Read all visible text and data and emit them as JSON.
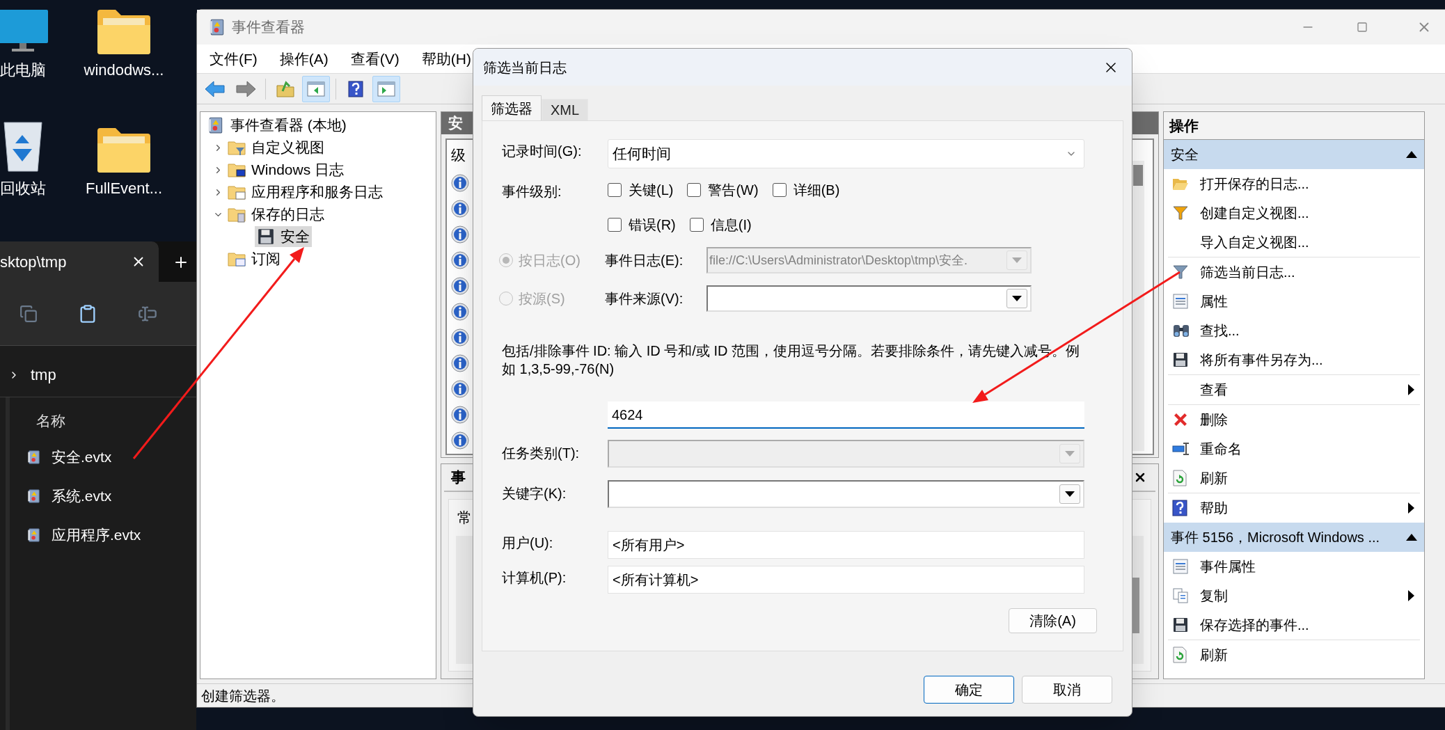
{
  "desktop": {
    "icons": [
      {
        "label": "此电脑",
        "kind": "pc"
      },
      {
        "label": "windodws...",
        "kind": "folder"
      },
      {
        "label": "回收站",
        "kind": "bin"
      },
      {
        "label": "FullEvent...",
        "kind": "folder"
      }
    ]
  },
  "explorer": {
    "tab": "sktop\\tmp",
    "breadcrumb": "tmp",
    "column": "名称",
    "files": [
      {
        "name": "安全.evtx"
      },
      {
        "name": "系统.evtx"
      },
      {
        "name": "应用程序.evtx"
      }
    ]
  },
  "event_viewer": {
    "title": "事件查看器",
    "menu": [
      "文件(F)",
      "操作(A)",
      "查看(V)",
      "帮助(H)"
    ],
    "toolbar": [
      {
        "kind": "back",
        "pressed": false
      },
      {
        "kind": "forward",
        "pressed": false
      },
      {
        "kind": "up",
        "pressed": false
      },
      {
        "kind": "tree",
        "pressed": true
      },
      {
        "kind": "help",
        "pressed": false
      },
      {
        "kind": "actions",
        "pressed": true
      }
    ],
    "tree": {
      "label": "事件查看器 (本地)",
      "kind": "root",
      "selected": false,
      "children": [
        {
          "label": "自定义视图",
          "kind": "filter",
          "expanded": false,
          "selected": false
        },
        {
          "label": "Windows 日志",
          "kind": "monitor",
          "expanded": false,
          "selected": false
        },
        {
          "label": "应用程序和服务日志",
          "kind": "window",
          "expanded": false,
          "selected": false
        },
        {
          "label": "保存的日志",
          "kind": "saved",
          "expanded": true,
          "selected": false,
          "children": [
            {
              "label": "安全",
              "kind": "disk",
              "selected": true
            }
          ]
        },
        {
          "label": "订阅",
          "kind": "subscription",
          "selected": false
        }
      ]
    },
    "log_pane": {
      "header": "安",
      "column": "级",
      "events": [
        {
          "kind": "info"
        },
        {
          "kind": "info"
        },
        {
          "kind": "info"
        },
        {
          "kind": "info"
        },
        {
          "kind": "info"
        },
        {
          "kind": "info"
        },
        {
          "kind": "info"
        },
        {
          "kind": "info"
        },
        {
          "kind": "info"
        },
        {
          "kind": "info"
        },
        {
          "kind": "info"
        }
      ]
    },
    "detail_pane": {
      "header": "事",
      "tab": "常"
    },
    "actions": {
      "title": "操作",
      "sections": [
        {
          "title": "安全",
          "expanded": true,
          "groups": [
            [
              {
                "label": "打开保存的日志...",
                "kind": "open",
                "submenu": false
              },
              {
                "label": "创建自定义视图...",
                "kind": "custom-view",
                "submenu": false
              },
              {
                "label": "导入自定义视图...",
                "kind": "plain",
                "submenu": false
              }
            ],
            [
              {
                "label": "筛选当前日志...",
                "kind": "filter",
                "submenu": false
              },
              {
                "label": "属性",
                "kind": "properties",
                "submenu": false
              },
              {
                "label": "查找...",
                "kind": "find",
                "submenu": false
              },
              {
                "label": "将所有事件另存为...",
                "kind": "save",
                "submenu": false
              }
            ],
            [
              {
                "label": "查看",
                "kind": "plain",
                "submenu": true
              }
            ],
            [
              {
                "label": "删除",
                "kind": "delete",
                "submenu": false
              },
              {
                "label": "重命名",
                "kind": "rename",
                "submenu": false
              },
              {
                "label": "刷新",
                "kind": "refresh",
                "submenu": false
              }
            ],
            [
              {
                "label": "帮助",
                "kind": "help",
                "submenu": true
              }
            ]
          ]
        },
        {
          "title": "事件 5156，Microsoft Windows ...",
          "expanded": true,
          "groups": [
            [
              {
                "label": "事件属性",
                "kind": "properties",
                "submenu": false
              },
              {
                "label": "复制",
                "kind": "copy",
                "submenu": true
              },
              {
                "label": "保存选择的事件...",
                "kind": "save",
                "submenu": false
              }
            ],
            [
              {
                "label": "刷新",
                "kind": "refresh",
                "submenu": false
              }
            ]
          ]
        }
      ]
    },
    "status_bar": "创建筛选器。"
  },
  "dialog": {
    "title": "筛选当前日志",
    "tabs": [
      {
        "label": "筛选器",
        "selected": true
      },
      {
        "label": "XML",
        "selected": false
      }
    ],
    "logged": {
      "label": "记录时间(G):",
      "value": "任何时间"
    },
    "levels": {
      "label": "事件级别:",
      "options": [
        {
          "label": "关键(L)",
          "checked": false
        },
        {
          "label": "警告(W)",
          "checked": false
        },
        {
          "label": "详细(B)",
          "checked": false
        },
        {
          "label": "错误(R)",
          "checked": false
        },
        {
          "label": "信息(I)",
          "checked": false
        }
      ]
    },
    "sources": [
      {
        "label": "按日志(O)",
        "selected": true,
        "disabled": true,
        "field_label": "事件日志(E):",
        "field_disabled": true,
        "value": "file://C:\\Users\\Administrator\\Desktop\\tmp\\安全."
      },
      {
        "label": "按源(S)",
        "selected": false,
        "disabled": true,
        "field_label": "事件来源(V):",
        "field_disabled": false
      }
    ],
    "id_help": "包括/排除事件 ID: 输入 ID 号和/或 ID 范围，使用逗号分隔。若要排除条件，请先键入减号。例如 1,3,5-99,-76(N)",
    "event_ids": "4624",
    "task_category": {
      "label": "任务类别(T):",
      "disabled": true
    },
    "keywords": {
      "label": "关键字(K):",
      "disabled": false
    },
    "user": {
      "label": "用户(U):",
      "value": "<所有用户>"
    },
    "computer": {
      "label": "计算机(P):",
      "value": "<所有计算机>"
    },
    "clear": "清除(A)",
    "buttons": [
      {
        "label": "确定",
        "default": true
      },
      {
        "label": "取消",
        "default": false
      }
    ]
  }
}
